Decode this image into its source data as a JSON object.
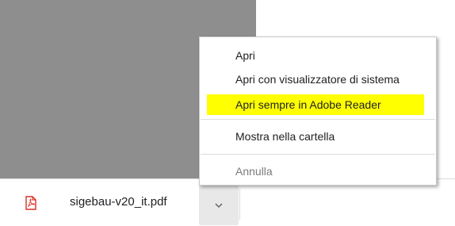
{
  "download_item": {
    "file_name": "sigebau-v20_it.pdf",
    "file_icon": "pdf-file-icon",
    "menu_button_icon": "chevron-down-icon"
  },
  "context_menu": {
    "items": [
      {
        "label": "Apri",
        "enabled": true
      },
      {
        "label": "Apri con visualizzatore di sistema",
        "enabled": true
      },
      {
        "label": "Apri sempre in Adobe Reader",
        "enabled": true,
        "highlighted": true
      },
      {
        "label": "Mostra nella cartella",
        "enabled": true
      },
      {
        "label": "Annulla",
        "enabled": false
      }
    ],
    "highlight_color": "#ffff00"
  },
  "colors": {
    "gray_area": "#8e8e8e",
    "pdf_red": "#d93025"
  }
}
